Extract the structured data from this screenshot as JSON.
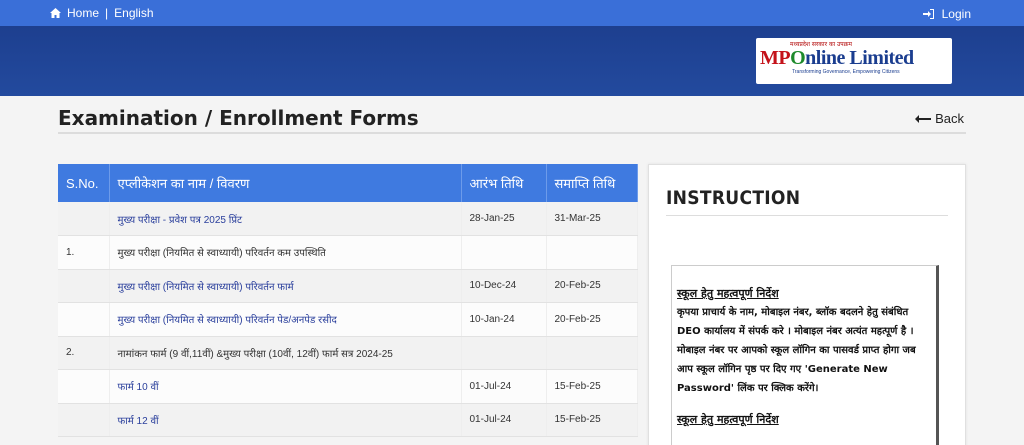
{
  "topbar": {
    "home_label": "Home",
    "separator": "|",
    "lang_label": "English",
    "login_label": "Login"
  },
  "logo": {
    "tagline_top": "मध्यप्रदेश सरकार का उपक्रम",
    "brand_mp": "MP",
    "brand_o": "O",
    "brand_rest": "nline Limited",
    "tagline_bottom": "Transforming Governance, Empowering Citizens"
  },
  "page": {
    "title": "Examination / Enrollment Forms",
    "back_label": "Back"
  },
  "table": {
    "headers": [
      "S.No.",
      "एप्लीकेशन का नाम / विवरण",
      "आरंभ तिथि",
      "समाप्ति तिथि"
    ],
    "rows": [
      {
        "sno": "",
        "name": "मुख्य परीक्षा - प्रवेश पत्र 2025 प्रिंट",
        "start": "28-Jan-25",
        "end": "31-Mar-25",
        "link": true
      },
      {
        "sno": "1.",
        "name": "मुख्य परीक्षा (नियमित से स्वाध्यायी) परिवर्तन कम उपस्थिति",
        "start": "",
        "end": "",
        "link": false
      },
      {
        "sno": "",
        "name": "मुख्य परीक्षा (नियमित से स्वाध्यायी) परिवर्तन फार्म",
        "start": "10-Dec-24",
        "end": "20-Feb-25",
        "link": true
      },
      {
        "sno": "",
        "name": "मुख्य परीक्षा (नियमित से स्वाध्यायी) परिवर्तन पेड/अनपेड रसीद",
        "start": "10-Jan-24",
        "end": "20-Feb-25",
        "link": true
      },
      {
        "sno": "2.",
        "name": "नामांकन फार्म (9 वीं,11वीं) &मुख्य परीक्षा (10वीं, 12वीं) फार्म सत्र 2024-25",
        "start": "",
        "end": "",
        "link": false
      },
      {
        "sno": "",
        "name": "फार्म 10 वीं",
        "start": "01-Jul-24",
        "end": "15-Feb-25",
        "link": true
      },
      {
        "sno": "",
        "name": "फार्म 12 वीं",
        "start": "01-Jul-24",
        "end": "15-Feb-25",
        "link": true
      }
    ]
  },
  "instruction": {
    "title": "INSTRUCTION",
    "heading": "स्कूल हेतु महत्वपूर्ण निर्देश",
    "text": "कृपया प्राचार्य के नाम, मोबाइल नंबर, ब्लॉक बदलने हेतु संबंधित DEO कार्यालय में संपर्क करे । मोबाइल नंबर अत्यंत महत्पूर्ण है । मोबाइल नंबर पर आपको स्कूल लॉगिन का पासवर्ड प्राप्त होगा जब आप स्कूल लॉगिन पृष्ठ पर दिए गए 'Generate New Password' लिंक पर क्लिक करेंगे।",
    "heading2": "स्कूल हेतु महत्वपूर्ण निर्देश"
  }
}
